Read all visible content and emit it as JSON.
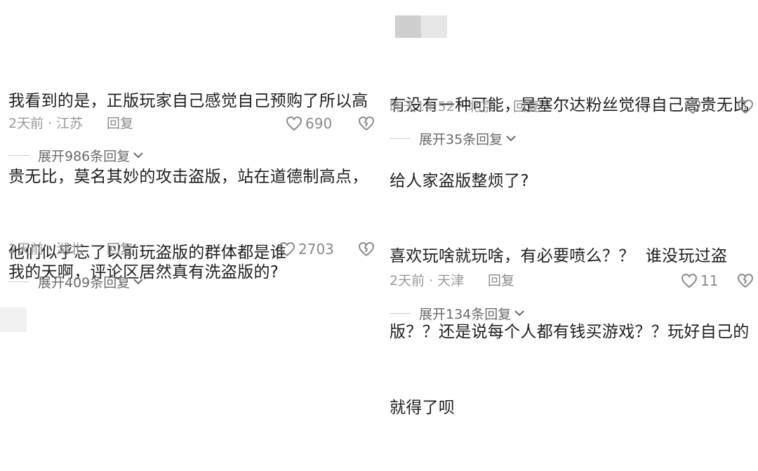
{
  "comments_left": [
    {
      "text_lines": [
        "我看到的是，正版玩家自己感觉自己预购了所以高",
        "贵无比，莫名其妙的攻击盗版，站在道德制高点，",
        "他们似乎忘了以前玩盗版的群体都是谁"
      ],
      "time": "2天前",
      "location": "江苏",
      "reply_label": "回复",
      "likes": "690",
      "expand_label": "展开986条回复"
    },
    {
      "text_lines": [
        "我的天啊，评论区居然真有洗盗版的?"
      ],
      "time": "2天前",
      "location": "湖北",
      "reply_label": "回复",
      "likes": "2703",
      "expand_label": "展开409条回复"
    }
  ],
  "comments_right": [
    {
      "text_lines": [
        "有没有一种可能，是塞尔达粉丝觉得自己高贵无比",
        "给人家盗版整烦了?"
      ],
      "time": "昨天14:52",
      "location": "北京",
      "reply_label": "回复",
      "likes": "7",
      "expand_label": "展开35条回复"
    },
    {
      "text_lines": [
        "喜欢玩啥就玩啥，有必要喷么？？  谁没玩过盗",
        "版？？还是说每个人都有钱买游戏？？玩好自己的",
        "就得了呗"
      ],
      "time": "2天前",
      "location": "天津",
      "reply_label": "回复",
      "likes": "11",
      "expand_label": "展开134条回复"
    }
  ],
  "colors": {
    "text": "#1f1f1f",
    "meta": "#9a9a9a",
    "icon": "#8a8a8a"
  }
}
